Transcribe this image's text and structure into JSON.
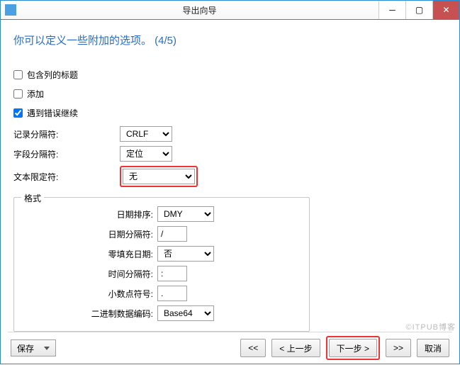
{
  "window": {
    "title": "导出向导"
  },
  "heading": "你可以定义一些附加的选项。 (4/5)",
  "checkboxes": {
    "include_headers": {
      "label": "包含列的标题",
      "checked": false
    },
    "append": {
      "label": "添加",
      "checked": false
    },
    "continue_on_error": {
      "label": "遇到错误继续",
      "checked": true
    }
  },
  "separators": {
    "record": {
      "label": "记录分隔符:",
      "value": "CRLF"
    },
    "field": {
      "label": "字段分隔符:",
      "value": "定位"
    },
    "text_qualifier": {
      "label": "文本限定符:",
      "value": "无"
    }
  },
  "format_group": {
    "legend": "格式",
    "date_order": {
      "label": "日期排序:",
      "value": "DMY"
    },
    "date_sep": {
      "label": "日期分隔符:",
      "value": "/"
    },
    "zero_pad": {
      "label": "零填充日期:",
      "value": "否"
    },
    "time_sep": {
      "label": "时间分隔符:",
      "value": ":"
    },
    "decimal": {
      "label": "小数点符号:",
      "value": "."
    },
    "binary_enc": {
      "label": "二进制数据编码:",
      "value": "Base64"
    }
  },
  "footer": {
    "save": "保存",
    "first": "<<",
    "prev": "< 上一步",
    "next": "下一步 >",
    "last": ">>",
    "cancel": "取消"
  },
  "watermark": "©ITPUB博客"
}
